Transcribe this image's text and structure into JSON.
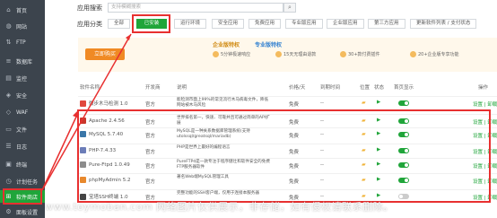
{
  "sidebar": {
    "items": [
      {
        "label": "首页",
        "icon": "home-icon",
        "glyph": "⌂"
      },
      {
        "label": "网站",
        "icon": "globe-icon",
        "glyph": "◍"
      },
      {
        "label": "FTP",
        "icon": "ftp-icon",
        "glyph": "⇅"
      },
      {
        "label": "数据库",
        "icon": "database-icon",
        "glyph": "≡"
      },
      {
        "label": "监控",
        "icon": "monitor-icon",
        "glyph": "▤"
      },
      {
        "label": "安全",
        "icon": "shield-icon",
        "glyph": "◈"
      },
      {
        "label": "WAF",
        "icon": "waf-icon",
        "glyph": "◇"
      },
      {
        "label": "文件",
        "icon": "folder-icon",
        "glyph": "▭"
      },
      {
        "label": "日志",
        "icon": "log-icon",
        "glyph": "☰"
      },
      {
        "label": "终端",
        "icon": "terminal-icon",
        "glyph": "▣"
      },
      {
        "label": "计划任务",
        "icon": "clock-icon",
        "glyph": "◷"
      },
      {
        "label": "软件商店",
        "icon": "store-icon",
        "glyph": "⊞"
      },
      {
        "label": "面板设置",
        "icon": "gear-icon",
        "glyph": "⚙"
      }
    ]
  },
  "search": {
    "label": "应用搜索",
    "placeholder": "支持模糊搜索",
    "icon": "search-icon"
  },
  "categories": {
    "label": "应用分类",
    "items": [
      "全部",
      "已安装",
      "运行环境",
      "安全应用",
      "免费应用",
      "专业版应用",
      "企业版应用",
      "第三方应用"
    ],
    "update": "更新软件列表 / 支付状态"
  },
  "banner": {
    "buy": "立即购买",
    "enterprise": "企业版特权",
    "pro": "专业版特权",
    "features": [
      "5分钟极速响应",
      "15天无理由退款",
      "30+款付费插件",
      "20+企业版专享功能"
    ]
  },
  "table": {
    "headers": [
      "软件名称",
      "开发商",
      "说明",
      "价格/天",
      "到期时间",
      "位置",
      "状态",
      "首页显示",
      "操作"
    ],
    "rows": [
      {
        "name": "微步木马检测 1.0",
        "dev": "官方",
        "desc": "能检测市面上99%的常见流行木马病毒文件，降低网站被木马风险",
        "price": "免费",
        "expire": "--",
        "ops": "设置 | 卸载",
        "color": "#e0483d",
        "on": true
      },
      {
        "name": "Apache 2.4.56",
        "dev": "官方",
        "desc": "世界排名第一，快速、可靠并且可通过简单的API扩展",
        "price": "免费",
        "expire": "--",
        "ops": "设置 | 卸载",
        "color": "#c9362a",
        "on": true
      },
      {
        "name": "MySQL 5.7.40",
        "dev": "官方",
        "desc": "MySQL是一种关系数据库管理系统(支持utolssql/greatsql/mariadb)",
        "price": "免费",
        "expire": "--",
        "ops": "设置 | 卸载",
        "color": "#3a76a8",
        "on": true
      },
      {
        "name": "PHP-7.4.33",
        "dev": "官方",
        "desc": "PHP是世界上最好的编程语言",
        "price": "免费",
        "expire": "--",
        "ops": "设置 | 卸载",
        "color": "#6c7db8",
        "on": true
      },
      {
        "name": "Pure-Ftpd 1.0.49",
        "dev": "官方",
        "desc": "PureFTPd是一款专注于程序健壮和软件安全的免费FTP服务器软件",
        "price": "免费",
        "expire": "--",
        "ops": "设置 | 卸载",
        "color": "#8c8c8c",
        "on": true
      },
      {
        "name": "phpMyAdmin 5.2",
        "dev": "官方",
        "desc": "著名Web端MySQL管理工具",
        "price": "免费",
        "expire": "--",
        "ops": "设置 | 卸载",
        "color": "#e8892d",
        "on": true
      },
      {
        "name": "宝塔SSH终端 1.0",
        "dev": "官方",
        "desc": "完整功能的SSH客户端，仅用于连接本服务器",
        "price": "免费",
        "expire": "--",
        "ops": "设置 | 卸载",
        "color": "#444",
        "on": false
      }
    ]
  },
  "watermark": "www.toymoban.com 网络图片仅供展示，非存储，如有侵权请联系删除。",
  "colors": {
    "accent": "#20a53a",
    "sidebar": "#3c444d",
    "highlight": "#e83030",
    "buy": "#f08a24"
  }
}
